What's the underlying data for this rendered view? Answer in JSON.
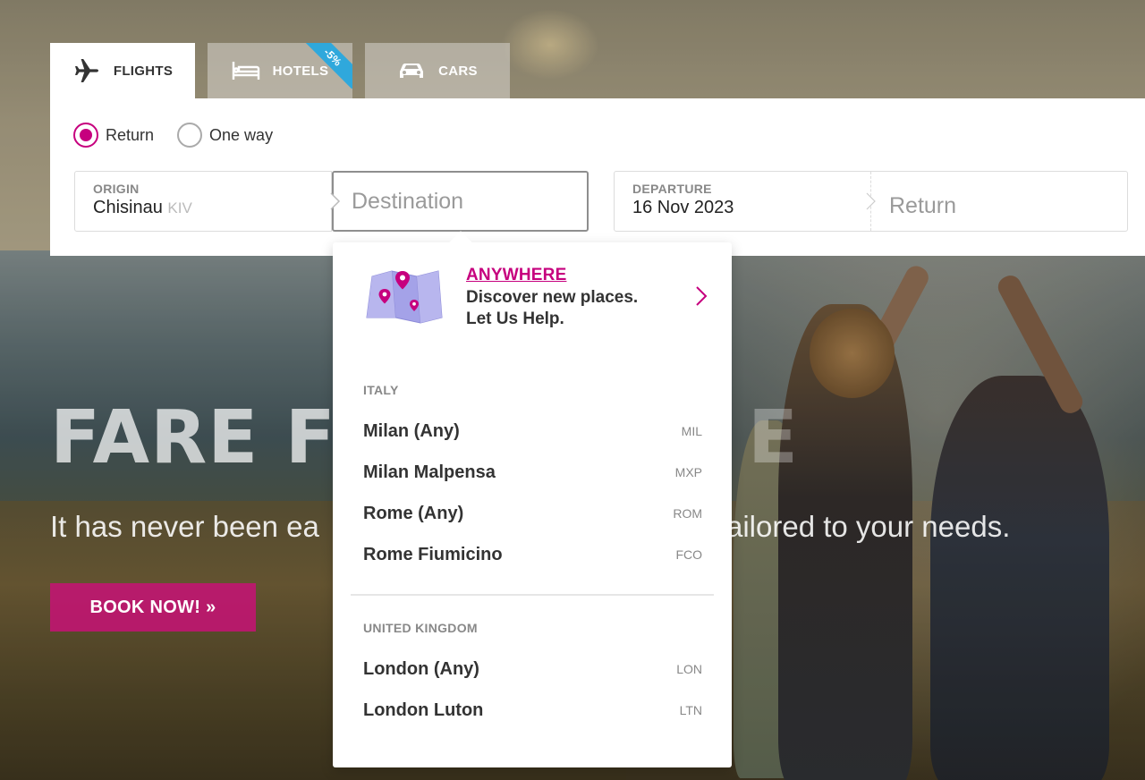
{
  "tabs": [
    {
      "label": "FLIGHTS",
      "icon": "airplane-icon",
      "active": true
    },
    {
      "label": "HOTELS",
      "icon": "bed-icon",
      "active": false,
      "badge": "-5%"
    },
    {
      "label": "CARS",
      "icon": "car-icon",
      "active": false
    }
  ],
  "trip_type": {
    "options": [
      "Return",
      "One way"
    ],
    "selected": "Return"
  },
  "search": {
    "origin_label": "ORIGIN",
    "origin_city": "Chisinau",
    "origin_code": "KIV",
    "destination_placeholder": "Destination",
    "departure_label": "DEPARTURE",
    "departure_date": "16 Nov 2023",
    "return_placeholder": "Return"
  },
  "dropdown": {
    "anywhere_title": "ANYWHERE",
    "anywhere_line1": "Discover new places.",
    "anywhere_line2": "Let Us Help.",
    "groups": [
      {
        "country": "ITALY",
        "items": [
          {
            "city": "Milan (Any)",
            "code": "MIL"
          },
          {
            "city": "Milan Malpensa",
            "code": "MXP"
          },
          {
            "city": "Rome (Any)",
            "code": "ROM"
          },
          {
            "city": "Rome Fiumicino",
            "code": "FCO"
          }
        ]
      },
      {
        "country": "UNITED KINGDOM",
        "items": [
          {
            "city": "London (Any)",
            "code": "LON"
          },
          {
            "city": "London Luton",
            "code": "LTN"
          }
        ]
      }
    ]
  },
  "hero": {
    "title_visible": "FARE F",
    "title_visible_right": "E",
    "subtitle_left": "It has never been ea",
    "subtitle_right": "ailored to your needs.",
    "book_button": "BOOK NOW! »"
  },
  "colors": {
    "accent": "#c6007e",
    "badge": "#2fa8dc",
    "book_button": "#c71276"
  }
}
